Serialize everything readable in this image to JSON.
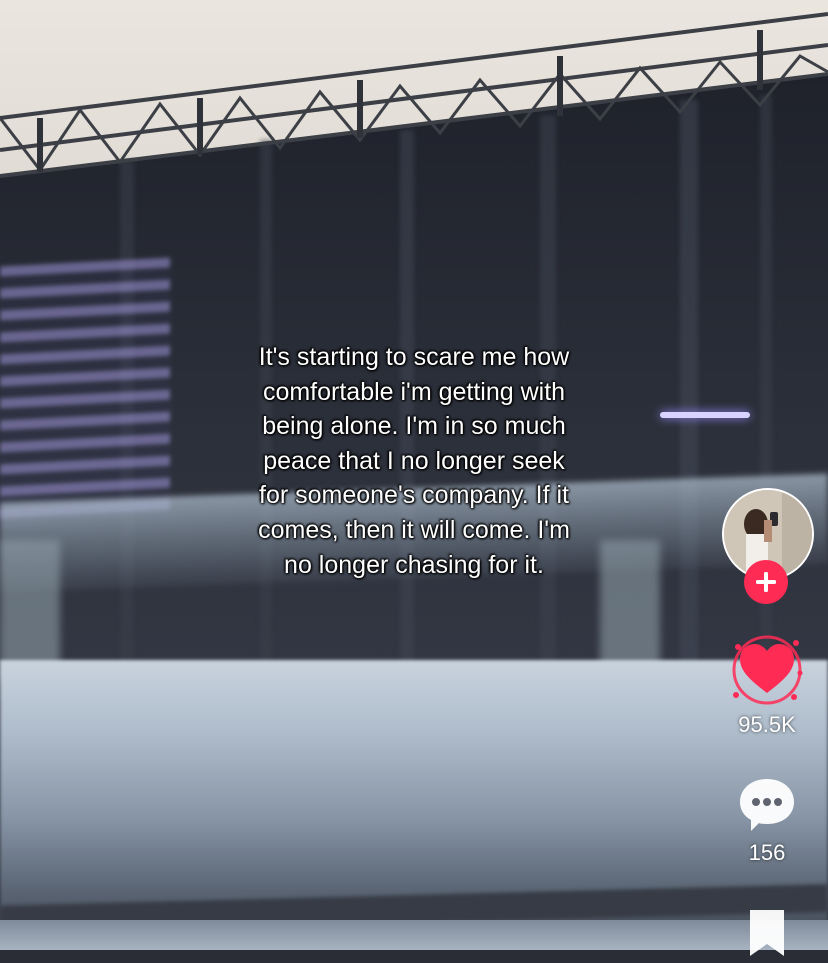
{
  "caption": {
    "lines": [
      "It's starting to scare me how",
      "comfortable i'm getting with",
      "being alone. I'm in so much",
      "peace that I no longer seek",
      "for someone's company. If it",
      "comes, then it will come. I'm",
      "no longer chasing for it."
    ]
  },
  "sidebar": {
    "avatar_icon": "creator-avatar",
    "follow_icon": "plus-icon",
    "like": {
      "icon": "heart-icon",
      "count": "95.5K",
      "color": "#fe2c55",
      "liked": true
    },
    "comment": {
      "icon": "comment-bubble-icon",
      "count": "156"
    },
    "save": {
      "icon": "bookmark-icon"
    }
  },
  "colors": {
    "accent": "#fe2c55"
  }
}
